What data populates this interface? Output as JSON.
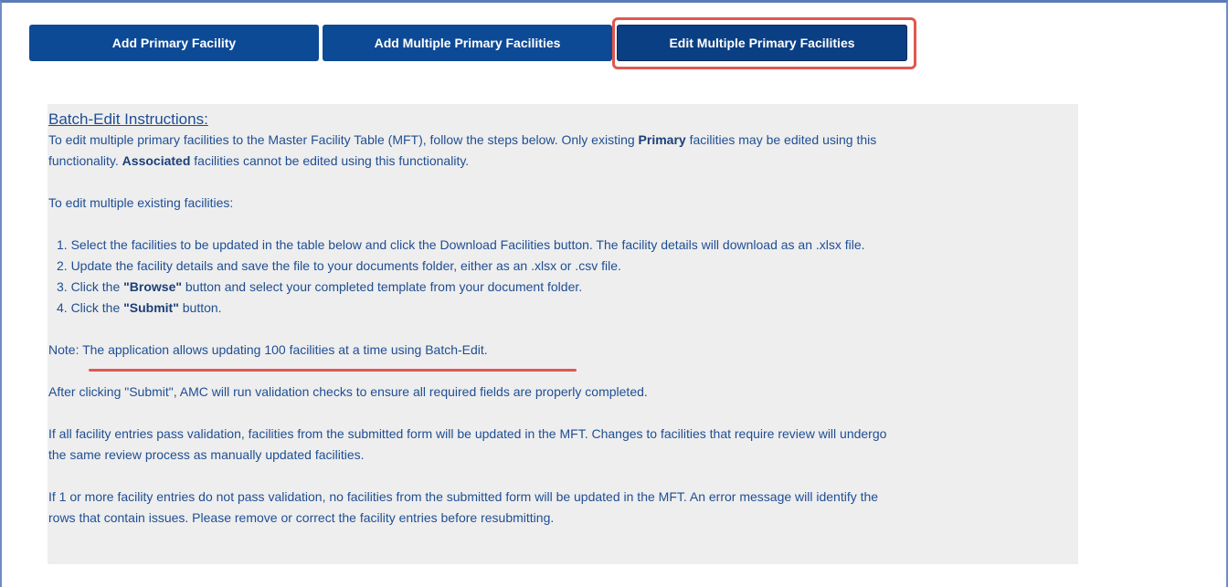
{
  "tabs": {
    "add_primary": "Add Primary Facility",
    "add_multiple": "Add Multiple Primary Facilities",
    "edit_multiple": "Edit Multiple Primary Facilities"
  },
  "instructions": {
    "heading": "Batch-Edit Instructions:",
    "intro_1": "To edit multiple primary facilities to the Master Facility Table (MFT), follow the steps below. Only existing ",
    "intro_bold_1": "Primary",
    "intro_2": " facilities may be edited using this",
    "intro_3": "functionality. ",
    "intro_bold_2": "Associated",
    "intro_4": " facilities cannot be edited using this functionality.",
    "to_edit": "To edit multiple existing facilities:",
    "step1": "1. Select the facilities to be updated in the table below and click the Download Facilities button. The facility details will download as an .xlsx file.",
    "step2": "2. Update the facility details and save the file to your documents folder, either as an .xlsx or .csv file.",
    "step3_a": "3. Click the ",
    "step3_bold": "\"Browse\"",
    "step3_b": " button and select your completed template from your document folder.",
    "step4_a": "4. Click the ",
    "step4_bold": "\"Submit\"",
    "step4_b": " button.",
    "note": "Note: The application allows updating 100 facilities at a time using Batch-Edit.",
    "after_submit": "After clicking \"Submit\", AMC will run validation checks to ensure all required fields are properly completed.",
    "pass_1": "If all facility entries pass validation, facilities from the submitted form will be updated in the MFT. Changes to facilities that require review will undergo",
    "pass_2": "the same review process as manually updated facilities.",
    "fail_1": "If 1 or more facility entries do not pass validation, no facilities from the submitted form will be updated in the MFT. An error message will identify the",
    "fail_2": "rows that contain issues. Please remove or correct the facility entries before resubmitting."
  },
  "colors": {
    "tab_bg": "#0d4a96",
    "text": "#1f4e93",
    "highlight": "#e0574f",
    "panel_bg": "#eeeeee"
  }
}
